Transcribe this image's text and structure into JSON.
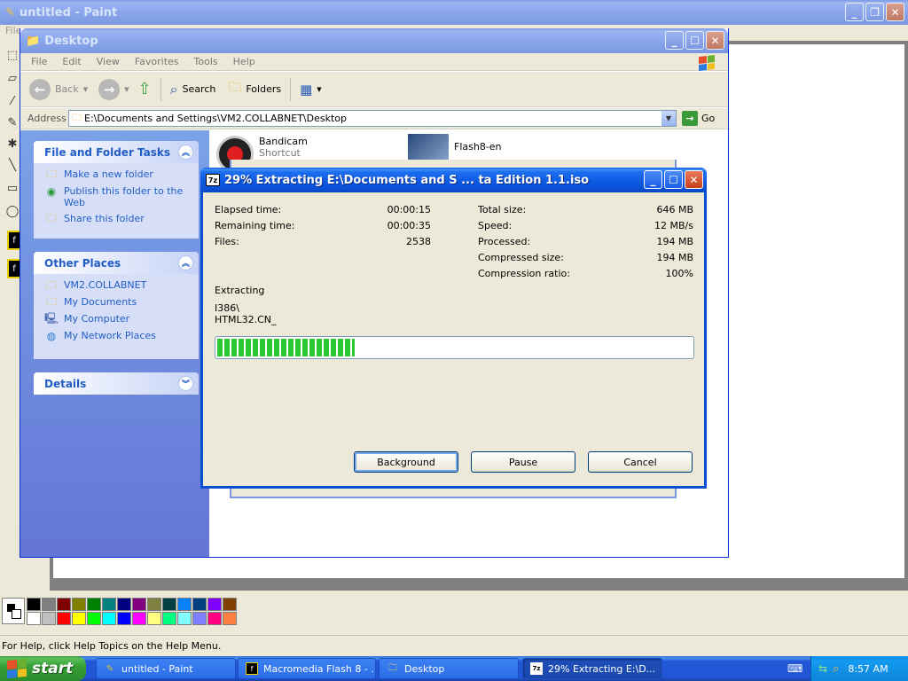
{
  "paint": {
    "title": "untitled - Paint",
    "menu_partial": "File",
    "status": "For Help, click Help Topics on the Help Menu.",
    "palette": [
      "#000000",
      "#808080",
      "#800000",
      "#808000",
      "#008000",
      "#008080",
      "#000080",
      "#800080",
      "#808040",
      "#004040",
      "#0080ff",
      "#004080",
      "#8000ff",
      "#804000",
      "#ffffff",
      "#c0c0c0",
      "#ff0000",
      "#ffff00",
      "#00ff00",
      "#00ffff",
      "#0000ff",
      "#ff00ff",
      "#ffff80",
      "#00ff80",
      "#80ffff",
      "#8080ff",
      "#ff0080",
      "#ff8040"
    ]
  },
  "explorer": {
    "title": "Desktop",
    "menu": [
      "File",
      "Edit",
      "View",
      "Favorites",
      "Tools",
      "Help"
    ],
    "toolbar": {
      "back": "Back",
      "search": "Search",
      "folders": "Folders"
    },
    "address": {
      "label": "Address",
      "value": "E:\\Documents and Settings\\VM2.COLLABNET\\Desktop",
      "go": "Go"
    },
    "file_tasks": {
      "header": "File and Folder Tasks",
      "items": [
        "Make a new folder",
        "Publish this folder to the Web",
        "Share this folder"
      ]
    },
    "other_places": {
      "header": "Other Places",
      "items": [
        "VM2.COLLABNET",
        "My Documents",
        "My Computer",
        "My Network Places"
      ]
    },
    "details": {
      "header": "Details"
    },
    "files": [
      {
        "name": "Bandicam",
        "sub": "Shortcut"
      },
      {
        "name": "Flash8-en",
        "sub": ""
      }
    ]
  },
  "zip": {
    "title": "29% Extracting E:\\Documents and S ... ta Edition 1.1.iso",
    "left_stats": [
      {
        "label": "Elapsed time:",
        "value": "00:00:15"
      },
      {
        "label": "Remaining time:",
        "value": "00:00:35"
      },
      {
        "label": "Files:",
        "value": "2538"
      }
    ],
    "right_stats": [
      {
        "label": "Total size:",
        "value": "646 MB"
      },
      {
        "label": "Speed:",
        "value": "12 MB/s"
      },
      {
        "label": "Processed:",
        "value": "194 MB"
      },
      {
        "label": "Compressed size:",
        "value": "194 MB"
      },
      {
        "label": "Compression ratio:",
        "value": "100%"
      }
    ],
    "operation": "Extracting",
    "current_dir": "I386\\",
    "current_file": "HTML32.CN_",
    "progress_percent": 29,
    "buttons": {
      "background": "Background",
      "pause": "Pause",
      "cancel": "Cancel"
    }
  },
  "taskbar": {
    "start": "start",
    "tasks": [
      {
        "label": "untitled - Paint"
      },
      {
        "label": "Macromedia Flash 8 - ..."
      },
      {
        "label": "Desktop"
      },
      {
        "label": "29% Extracting E:\\D..."
      }
    ],
    "clock": "8:57 AM"
  }
}
